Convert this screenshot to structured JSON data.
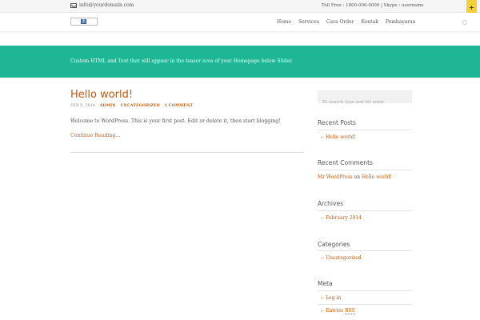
{
  "topbar": {
    "email": "info@yourdomain.com",
    "contact": "Toll Free : 1800-000-0000 | Skype : username",
    "toggle_glyph": "+"
  },
  "header": {
    "nav": [
      "Home",
      "Services",
      "Cara Order",
      "Kontak",
      "Pembayaran"
    ]
  },
  "teaser": {
    "text": "Custom HTML and Text that will appear in the teaser area of your Homepage below Slider."
  },
  "post": {
    "title": "Hello world!",
    "date": "FEB 9, 2014",
    "author": "ADMIN",
    "category": "UNCATEGORIZED",
    "comments": "1 COMMENT",
    "body": "Welcome to WordPress. This is your first post. Edit or delete it, then start blogging!",
    "continue": "Continue Reading..."
  },
  "sidebar": {
    "search_placeholder": "To search type and hit enter",
    "recent_posts": {
      "title": "Recent Posts",
      "items": [
        "Hello world!"
      ]
    },
    "recent_comments": {
      "title": "Recent Comments",
      "author": "Mr WordPress",
      "on": "on",
      "post": "Hello world!"
    },
    "archives": {
      "title": "Archives",
      "items": [
        "February 2014"
      ]
    },
    "categories": {
      "title": "Categories",
      "items": [
        "Uncategorized"
      ]
    },
    "meta": {
      "title": "Meta",
      "items": [
        "Log in",
        "Entries",
        "RSS"
      ]
    },
    "bullet": "»"
  },
  "colors": {
    "accent": "#cc5500",
    "teaser": "#1fb695",
    "toggle": "#f2d036"
  }
}
